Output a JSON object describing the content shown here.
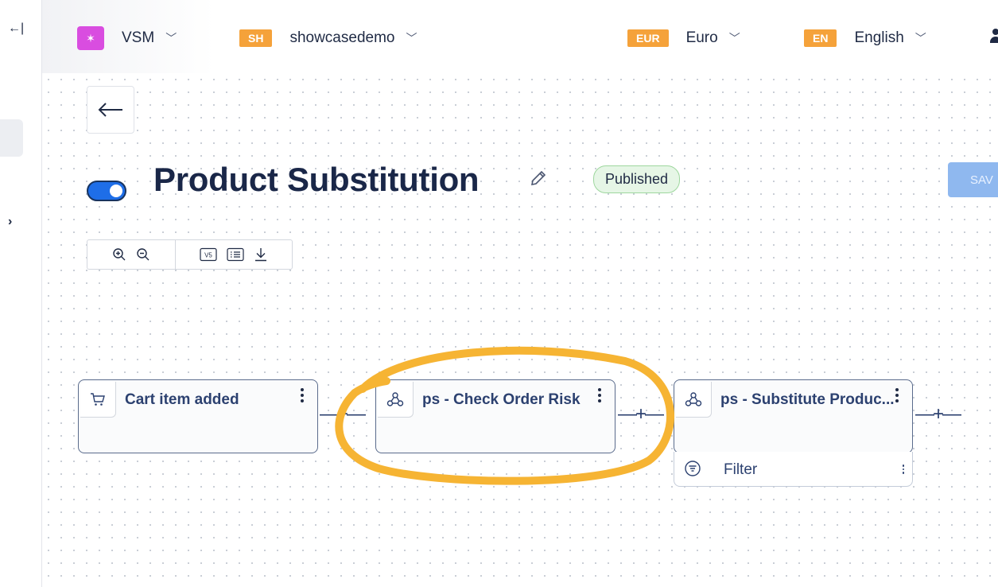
{
  "rail": {
    "collapse_glyph": "←|",
    "expand_glyph": "›"
  },
  "header": {
    "app": {
      "name": "VSM",
      "icon": "magic-wand-icon"
    },
    "workspace": {
      "badge": "SH",
      "name": "showcasedemo"
    },
    "currency": {
      "badge": "EUR",
      "name": "Euro"
    },
    "language": {
      "badge": "EN",
      "name": "English"
    },
    "chevron": "﹀"
  },
  "flow": {
    "title": "Product Substitution",
    "status": "Published",
    "save_label": "SAV",
    "enabled": true
  },
  "toolbar": {
    "version_label": "V5"
  },
  "nodes": [
    {
      "label": "Cart item added",
      "icon": "cart-icon"
    },
    {
      "label": "ps - Check Order Risk",
      "icon": "webhook-icon"
    },
    {
      "label": "ps - Substitute Produc...",
      "icon": "webhook-icon"
    }
  ],
  "filter": {
    "label": "Filter"
  },
  "connector_glyph": "—+—",
  "colors": {
    "accent": "#1e6ee8",
    "badge_orange": "#f5a23a",
    "app_icon": "#d94de0",
    "highlight": "#f6b433",
    "published_bg": "#e6f6e6"
  }
}
